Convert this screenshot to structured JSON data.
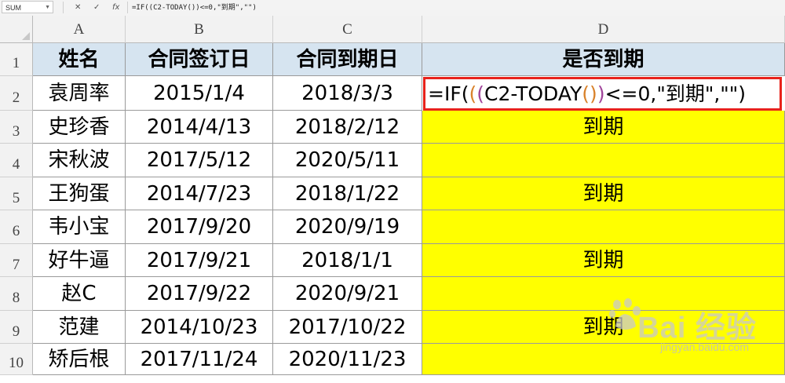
{
  "formula_bar": {
    "name_box": "SUM",
    "cancel_icon": "✕",
    "enter_icon": "✓",
    "fx_icon": "fx",
    "formula": "=IF((C2-TODAY())<=0,\"到期\",\"\")"
  },
  "columns": [
    "A",
    "B",
    "C",
    "D"
  ],
  "rows": [
    "1",
    "2",
    "3",
    "4",
    "5",
    "6",
    "7",
    "8",
    "9",
    "10"
  ],
  "table": {
    "headers": [
      "姓名",
      "合同签订日",
      "合同到期日",
      "是否到期"
    ],
    "records": [
      {
        "name": "袁周率",
        "sign": "2015/1/4",
        "expire": "2018/3/3",
        "status": ""
      },
      {
        "name": "史珍香",
        "sign": "2014/4/13",
        "expire": "2018/2/12",
        "status": "到期"
      },
      {
        "name": "宋秋波",
        "sign": "2017/5/12",
        "expire": "2020/5/11",
        "status": ""
      },
      {
        "name": "王狗蛋",
        "sign": "2014/7/23",
        "expire": "2018/1/22",
        "status": "到期"
      },
      {
        "name": "韦小宝",
        "sign": "2017/9/20",
        "expire": "2020/9/19",
        "status": ""
      },
      {
        "name": "好牛逼",
        "sign": "2017/9/21",
        "expire": "2018/1/1",
        "status": "到期"
      },
      {
        "name": "赵C",
        "sign": "2017/9/22",
        "expire": "2020/9/21",
        "status": ""
      },
      {
        "name": "范建",
        "sign": "2014/10/23",
        "expire": "2017/10/22",
        "status": "到期"
      },
      {
        "name": "矫后根",
        "sign": "2017/11/24",
        "expire": "2020/11/23",
        "status": ""
      }
    ]
  },
  "editing_cell": {
    "parts": [
      "=IF(",
      "(",
      "(",
      "C2-TODAY",
      "(",
      ")",
      ")",
      "<=0,\"到期\",\"\")"
    ]
  },
  "watermark": {
    "brand": "Bai  经验",
    "url": "jingyan.baidu.com"
  },
  "colors": {
    "header_fill": "#d6e4f0",
    "highlight_fill": "#ffff00",
    "edit_border": "#e8221b"
  }
}
